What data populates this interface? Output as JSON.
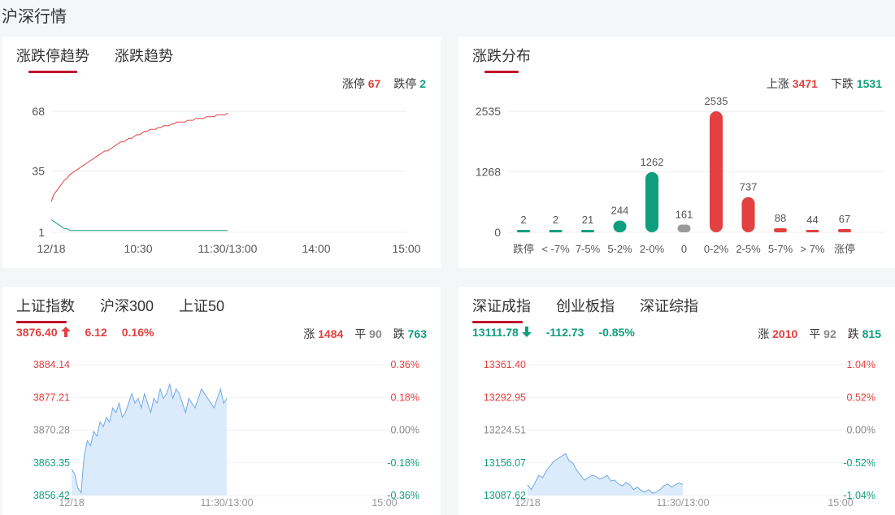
{
  "page_title": "沪深行情",
  "panel_limit": {
    "tabs": [
      "涨跌停趋势",
      "涨跌趋势"
    ],
    "limit_up_label": "涨停",
    "limit_up_value": "67",
    "limit_down_label": "跌停",
    "limit_down_value": "2",
    "colors": {
      "up": "#e34040",
      "down": "#0f9e7f"
    }
  },
  "panel_dist": {
    "tabs": [
      "涨跌分布"
    ],
    "up_label": "上涨",
    "up_value": "3471",
    "down_label": "下跌",
    "down_value": "1531"
  },
  "panel_sh": {
    "tabs": [
      "上证指数",
      "沪深300",
      "上证50"
    ],
    "price": "3876.40",
    "direction_icon": "arrow-up-icon",
    "change": "6.12",
    "change_pct": "0.16%",
    "up_label": "涨",
    "up_value": "1484",
    "flat_label": "平",
    "flat_value": "90",
    "down_label": "跌",
    "down_value": "763"
  },
  "panel_sz": {
    "tabs": [
      "深证成指",
      "创业板指",
      "深证综指"
    ],
    "price": "13111.78",
    "direction_icon": "arrow-down-icon",
    "change": "-112.73",
    "change_pct": "-0.85%",
    "up_label": "涨",
    "up_value": "2010",
    "flat_label": "平",
    "flat_value": "92",
    "down_label": "跌",
    "down_value": "815"
  },
  "chart_data": [
    {
      "type": "line",
      "x_ticks": [
        "12/18",
        "10:30",
        "11:30/13:00",
        "14:00",
        "15:00"
      ],
      "y_ticks": [
        "68",
        "35",
        "1"
      ],
      "ylim": [
        1,
        68
      ],
      "series": [
        {
          "color": "#e34040",
          "values": [
            18,
            22,
            24,
            26,
            28,
            30,
            31,
            33,
            34,
            35,
            36,
            37,
            38,
            39,
            40,
            41,
            42,
            43,
            44,
            45,
            46,
            46,
            47,
            48,
            49,
            50,
            51,
            51,
            52,
            53,
            53,
            54,
            55,
            55,
            56,
            57,
            57,
            58,
            58,
            58,
            59,
            59,
            60,
            60,
            60,
            61,
            61,
            62,
            62,
            62,
            62,
            63,
            63,
            63,
            64,
            64,
            64,
            64,
            65,
            65,
            65,
            65,
            66,
            66,
            66,
            66,
            67
          ]
        },
        {
          "color": "#0f9e7f",
          "values": [
            8,
            7,
            6,
            5,
            4,
            3,
            3,
            2,
            2,
            2,
            2,
            2,
            2,
            2,
            2,
            2,
            2,
            2,
            2,
            2,
            2,
            2,
            2,
            2,
            2,
            2,
            2,
            2,
            2,
            2,
            2,
            2,
            2,
            2,
            2,
            2,
            2,
            2,
            2,
            2,
            2,
            2,
            2,
            2,
            2,
            2,
            2,
            2,
            2,
            2,
            2,
            2,
            2,
            2,
            2,
            2,
            2,
            2,
            2,
            2,
            2,
            2,
            2,
            2,
            2,
            2,
            2
          ]
        }
      ]
    },
    {
      "type": "bar",
      "categories": [
        "跌停",
        "< -7%",
        "7-5%",
        "5-2%",
        "2-0%",
        "0",
        "0-2%",
        "2-5%",
        "5-7%",
        "> 7%",
        "涨停"
      ],
      "values": [
        2,
        2,
        21,
        244,
        1262,
        161,
        2535,
        737,
        88,
        44,
        67
      ],
      "bar_colors": [
        "#0f9e7f",
        "#0f9e7f",
        "#0f9e7f",
        "#0f9e7f",
        "#0f9e7f",
        "#999999",
        "#e34040",
        "#e34040",
        "#e34040",
        "#e34040",
        "#e34040"
      ],
      "y_ticks": [
        "2535",
        "1268",
        "0"
      ],
      "ylim": [
        0,
        2535
      ]
    },
    {
      "type": "area",
      "x_ticks": [
        "12/18",
        "11:30/13:00",
        "15:00"
      ],
      "y_ticks_left": [
        "3884.14",
        "3877.21",
        "3870.28",
        "3863.35",
        "3856.42"
      ],
      "y_ticks_right": [
        "0.36%",
        "0.18%",
        "0.00%",
        "-0.18%",
        "-0.36%"
      ],
      "ylim": [
        3856.42,
        3884.14
      ],
      "values": [
        3862,
        3861,
        3858,
        3857,
        3865,
        3868,
        3867,
        3870,
        3869,
        3872,
        3871,
        3873,
        3872,
        3875,
        3874,
        3876,
        3873,
        3874,
        3876,
        3878,
        3876,
        3877,
        3875,
        3878,
        3876,
        3874,
        3877,
        3876,
        3879,
        3877,
        3878,
        3880,
        3877,
        3879,
        3878,
        3876,
        3874,
        3877,
        3876,
        3875,
        3877,
        3879,
        3878,
        3877,
        3876,
        3875,
        3877,
        3879,
        3876,
        3877
      ],
      "color": "#6fa8e8"
    },
    {
      "type": "area",
      "x_ticks": [
        "12/18",
        "11:30/13:00",
        "15:00"
      ],
      "y_ticks_left": [
        "13361.40",
        "13292.95",
        "13224.51",
        "13156.07",
        "13087.62"
      ],
      "y_ticks_right": [
        "1.04%",
        "0.52%",
        "0.00%",
        "-0.52%",
        "-1.04%"
      ],
      "ylim": [
        13087.62,
        13361.4
      ],
      "values": [
        13110,
        13100,
        13115,
        13130,
        13125,
        13140,
        13150,
        13160,
        13165,
        13170,
        13175,
        13160,
        13155,
        13140,
        13130,
        13120,
        13125,
        13130,
        13128,
        13122,
        13125,
        13130,
        13118,
        13120,
        13112,
        13108,
        13115,
        13110,
        13100,
        13105,
        13098,
        13095,
        13100,
        13092,
        13095,
        13100,
        13108,
        13112,
        13105,
        13110,
        13114,
        13111
      ],
      "color": "#6fa8e8"
    }
  ]
}
